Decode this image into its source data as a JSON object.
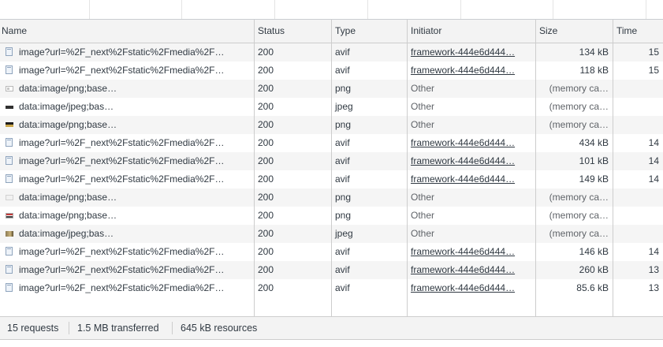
{
  "columns": {
    "name": "Name",
    "status": "Status",
    "type": "Type",
    "initiator": "Initiator",
    "size": "Size",
    "time": "Time"
  },
  "rows": [
    {
      "icon": "file-icon",
      "name": "image?url=%2F_next%2Fstatic%2Fmedia%2F…",
      "status": "200",
      "type": "avif",
      "initiator": "framework-444e6d444…",
      "initiator_link": true,
      "size": "134 kB",
      "time": "15"
    },
    {
      "icon": "file-icon",
      "name": "image?url=%2F_next%2Fstatic%2Fmedia%2F…",
      "status": "200",
      "type": "avif",
      "initiator": "framework-444e6d444…",
      "initiator_link": true,
      "size": "118 kB",
      "time": "15"
    },
    {
      "icon": "image-thumbnail-icon",
      "name": "data:image/png;base…",
      "status": "200",
      "type": "png",
      "initiator": "Other",
      "initiator_link": false,
      "size": "(memory ca…",
      "time": ""
    },
    {
      "icon": "image-thumbnail-icon",
      "name": "data:image/jpeg;bas…",
      "status": "200",
      "type": "jpeg",
      "initiator": "Other",
      "initiator_link": false,
      "size": "(memory ca…",
      "time": ""
    },
    {
      "icon": "image-thumbnail-icon",
      "name": "data:image/png;base…",
      "status": "200",
      "type": "png",
      "initiator": "Other",
      "initiator_link": false,
      "size": "(memory ca…",
      "time": ""
    },
    {
      "icon": "file-icon",
      "name": "image?url=%2F_next%2Fstatic%2Fmedia%2F…",
      "status": "200",
      "type": "avif",
      "initiator": "framework-444e6d444…",
      "initiator_link": true,
      "size": "434 kB",
      "time": "14"
    },
    {
      "icon": "file-icon",
      "name": "image?url=%2F_next%2Fstatic%2Fmedia%2F…",
      "status": "200",
      "type": "avif",
      "initiator": "framework-444e6d444…",
      "initiator_link": true,
      "size": "101 kB",
      "time": "14"
    },
    {
      "icon": "file-icon",
      "name": "image?url=%2F_next%2Fstatic%2Fmedia%2F…",
      "status": "200",
      "type": "avif",
      "initiator": "framework-444e6d444…",
      "initiator_link": true,
      "size": "149 kB",
      "time": "14"
    },
    {
      "icon": "image-thumbnail-icon",
      "name": "data:image/png;base…",
      "status": "200",
      "type": "png",
      "initiator": "Other",
      "initiator_link": false,
      "size": "(memory ca…",
      "time": ""
    },
    {
      "icon": "image-thumbnail-icon",
      "name": "data:image/png;base…",
      "status": "200",
      "type": "png",
      "initiator": "Other",
      "initiator_link": false,
      "size": "(memory ca…",
      "time": ""
    },
    {
      "icon": "image-thumbnail-icon",
      "name": "data:image/jpeg;bas…",
      "status": "200",
      "type": "jpeg",
      "initiator": "Other",
      "initiator_link": false,
      "size": "(memory ca…",
      "time": ""
    },
    {
      "icon": "file-icon",
      "name": "image?url=%2F_next%2Fstatic%2Fmedia%2F…",
      "status": "200",
      "type": "avif",
      "initiator": "framework-444e6d444…",
      "initiator_link": true,
      "size": "146 kB",
      "time": "14"
    },
    {
      "icon": "file-icon",
      "name": "image?url=%2F_next%2Fstatic%2Fmedia%2F…",
      "status": "200",
      "type": "avif",
      "initiator": "framework-444e6d444…",
      "initiator_link": true,
      "size": "260 kB",
      "time": "13"
    },
    {
      "icon": "file-icon",
      "name": "image?url=%2F_next%2Fstatic%2Fmedia%2F…",
      "status": "200",
      "type": "avif",
      "initiator": "framework-444e6d444…",
      "initiator_link": true,
      "size": "85.6 kB",
      "time": "13"
    }
  ],
  "summary": {
    "requests": "15 requests",
    "transferred": "1.5 MB transferred",
    "resources": "645 kB resources"
  }
}
